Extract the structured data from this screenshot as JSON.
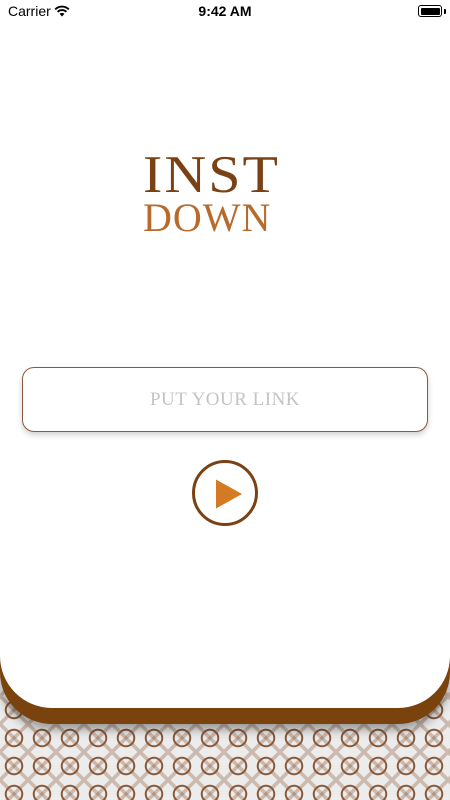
{
  "status_bar": {
    "carrier": "Carrier",
    "time": "9:42 AM"
  },
  "logo": {
    "line1": "INST",
    "line2": "DOWN"
  },
  "link_input": {
    "placeholder": "PUT YOUR LINK",
    "value": ""
  },
  "icons": {
    "wifi": "wifi-icon",
    "battery": "battery-icon",
    "play": "play-icon"
  },
  "colors": {
    "brand_dark": "#7a4214",
    "brand_light": "#b86a2c",
    "rim": "#7a420c",
    "placeholder": "#c4c4c4"
  }
}
